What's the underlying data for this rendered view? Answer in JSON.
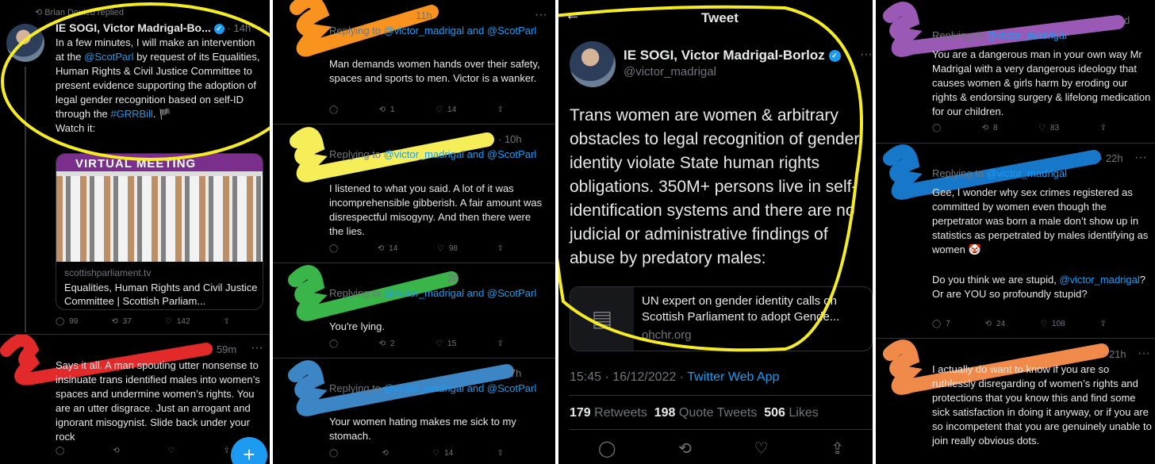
{
  "colors": {
    "accent": "#1d9bf0",
    "highlight": "#f5ec26",
    "bg": "#000000",
    "text": "#e7e9ea",
    "muted": "#71767b"
  },
  "p1": {
    "replied_by": "Brian Douieb replied",
    "author": "IE SOGI, Victor Madrigal-Bo...",
    "time": "· 14h",
    "body_pre": "In a few minutes, I will make an intervention at the ",
    "mention": "@ScotParl",
    "body_mid": " by request of its Equalities, Human Rights & Civil Justice Committee to present evidence supporting the adoption of legal gender recognition based on self-ID through the ",
    "hashtag": "#GRRBill",
    "flag": "🏴",
    "watch": "Watch it:",
    "card_banner": "VIRTUAL MEETING",
    "card_domain": "scottishparliament.tv",
    "card_title": "Equalities, Human Rights and Civil Justice Committee | Scottish Parliam...",
    "stats": {
      "replies": "99",
      "retweets": "37",
      "likes": "142"
    },
    "reply2_time": "· 59m",
    "reply2_body": "Says it all. A man spouting utter nonsense to insinuate trans identified males into women’s spaces and undermine women’s rights. You are an utter disgrace. Just an arrogant and ignorant misogynist. Slide back under your rock",
    "fab": "+"
  },
  "p2": {
    "r1": {
      "time": "11h",
      "replying": "Replying to",
      "to": "@victor_madrigal and @ScotParl",
      "body": "Man demands women hands over their safety, spaces and sports to men. Victor is a wanker.",
      "retweets": "1",
      "likes": "14"
    },
    "r2": {
      "time": "· 10h",
      "replying": "Replying to",
      "to": "@victor_madrigal and @ScotParl",
      "body": "I listened to what you said. A lot of it was incomprehensible gibberish. A fair amount was disrespectful misogyny. And then there were the lies.",
      "retweets": "14",
      "likes": "98"
    },
    "r3": {
      "time": "2h",
      "replying": "Replying to",
      "to": "@victor_madrigal and @ScotParl",
      "body": "You're lying.",
      "retweets": "2",
      "likes": "15"
    },
    "r4": {
      "time": "· 7h",
      "replying": "Replying to",
      "to": "@victor_madrigal and @ScotParl",
      "body": "Your women hating makes me sick to my stomach.",
      "likes": "14"
    }
  },
  "p3": {
    "header": "Tweet",
    "name": "IE SOGI, Victor Madrigal-Borloz",
    "handle": "@victor_madrigal",
    "body": "Trans women are women & arbitrary obstacles to legal recognition of gender identity violate State human rights obligations. 350M+ persons live in self-identification systems and there are no judicial or administrative findings of abuse by predatory males:",
    "card_title": "UN expert on gender identity calls on Scottish Parliament to adopt Gende...",
    "card_domain": "ohchr.org",
    "time": "15:45 · 16/12/2022 · ",
    "client": "Twitter Web App",
    "retweets_n": "179",
    "retweets_l": "Retweets",
    "quotes_n": "198",
    "quotes_l": "Quote Tweets",
    "likes_n": "506",
    "likes_l": "Likes"
  },
  "p4": {
    "r1": {
      "time": "d",
      "replying": "Replying to",
      "to": "@victor_madrigal",
      "body": "You are a dangerous man in your own way Mr Madrigal with a very dangerous ideology that causes women & girls harm by eroding our rights & endorsing surgery & lifelong medication for our children.",
      "retweets": "8",
      "likes": "83"
    },
    "r2": {
      "time": "· 22h",
      "replying": "Replying to",
      "to": "@victor_madrigal",
      "body": "Gee, I wonder why sex crimes registered as committed by women even though the perpetrator was born a male don’t show up in statistics as perpetrated by males identifying as women 🤡",
      "body2_pre": "Do you think we are stupid, ",
      "mention": "@victor_madrigal",
      "body2_post": "? Or are YOU so profoundly stupid?",
      "replies": "7",
      "retweets": "24",
      "likes": "108"
    },
    "r3": {
      "time": "· 21h",
      "body": "I actually do want to know if you are so ruthlessly disregarding of women’s rights and protections that you know this and find some sick satisfaction in doing it anyway, or if you are so incompetent that you are genuinely unable to join really obvious dots."
    }
  }
}
